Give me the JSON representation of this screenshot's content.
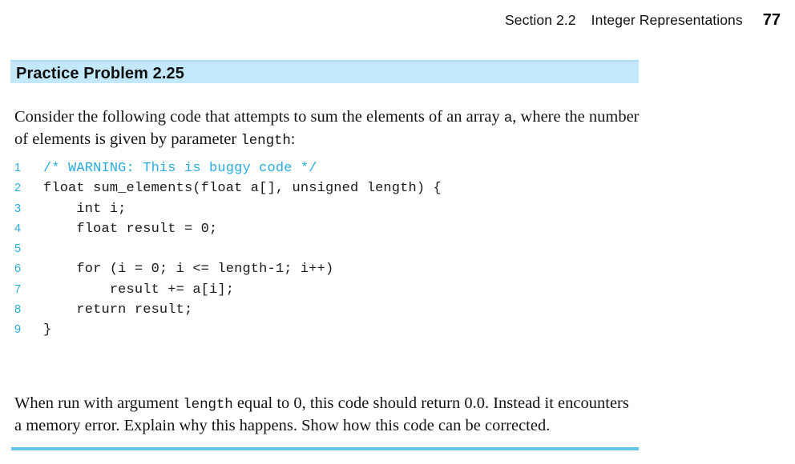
{
  "running_head": {
    "section": "Section 2.2",
    "title": "Integer Representations",
    "page_number": "77"
  },
  "banner": {
    "title": "Practice Problem 2.25",
    "background_color": "#c3e8fa",
    "border_color": "#a9ddf5"
  },
  "intro_paragraph": {
    "part1": "Consider the following code that attempts to sum the elements of an array ",
    "code1": "a",
    "part2": ", where the number of elements is given by parameter ",
    "code2": "length",
    "part3": ":"
  },
  "code_listing": {
    "accent_color": "#2aacdf",
    "lines": [
      {
        "number": "1",
        "text": "/* WARNING: This is buggy code */",
        "comment": true
      },
      {
        "number": "2",
        "text": "float sum_elements(float a[], unsigned length) {",
        "comment": false
      },
      {
        "number": "3",
        "text": "    int i;",
        "comment": false
      },
      {
        "number": "4",
        "text": "    float result = 0;",
        "comment": false
      },
      {
        "number": "5",
        "text": "",
        "comment": false
      },
      {
        "number": "6",
        "text": "    for (i = 0; i <= length-1; i++)",
        "comment": false
      },
      {
        "number": "7",
        "text": "        result += a[i];",
        "comment": false
      },
      {
        "number": "8",
        "text": "    return result;",
        "comment": false
      },
      {
        "number": "9",
        "text": "}",
        "comment": false
      }
    ]
  },
  "outro_paragraph": {
    "part1": "When run with argument ",
    "code1": "length",
    "part2": " equal to 0, this code should return 0.0. Instead it encounters a memory error. Explain why this happens. Show how this code can be corrected."
  },
  "bottom_rule": {
    "color": "#62c6e8"
  }
}
